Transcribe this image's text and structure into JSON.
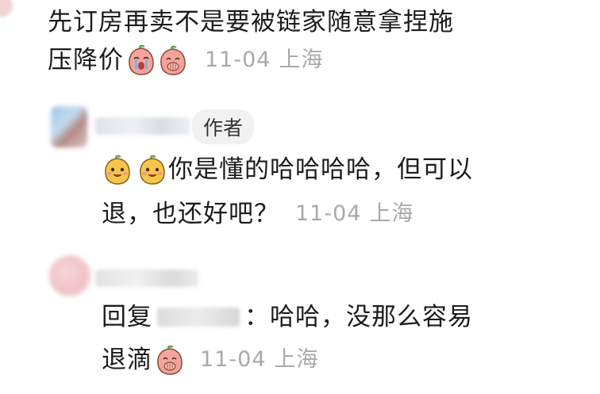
{
  "comment1": {
    "text_line1": "先订房再卖不是要被链家随意拿捏施",
    "text_line2": "压降价",
    "emojis": [
      "crying-peach-emoji",
      "peach-hand-mouth-emoji"
    ],
    "date": "11-04",
    "location": "上海"
  },
  "reply1": {
    "author_badge": "作者",
    "emojis": [
      "yellow-peach-emoji",
      "yellow-peach-emoji"
    ],
    "text_line1": "你是懂的哈哈哈哈，但可以",
    "text_line2": "退，也还好吧？",
    "date": "11-04",
    "location": "上海"
  },
  "reply2": {
    "prefix": "回复",
    "suffix_line1": "：哈哈，没那么容易",
    "text_line2": "退滴",
    "emojis": [
      "peach-hand-mouth-emoji"
    ],
    "date": "11-04",
    "location": "上海"
  },
  "colors": {
    "meta_gray": "#a9a9a9",
    "badge_bg": "#f1f1f1",
    "peach": "#f4a49a",
    "yellow": "#f6c54a"
  }
}
